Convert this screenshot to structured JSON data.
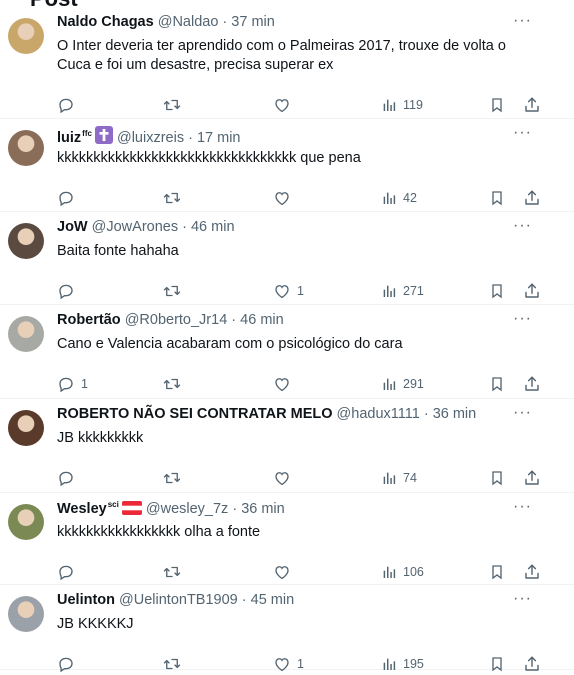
{
  "posts": [
    {
      "name": "Naldo Chagas",
      "handle": "@Naldao",
      "time": "37 min",
      "text": "O Inter deveria ter aprendido com o Palmeiras 2017, trouxe de volta o Cuca e foi um desastre, precisa superar ex",
      "replies": "",
      "likes": "",
      "views": "119",
      "avatar_color": "#c9a76a"
    },
    {
      "name": "luiz",
      "name_sup": "ffc",
      "handle": "@luixzreis",
      "time": "17 min",
      "text": "kkkkkkkkkkkkkkkkkkkkkkkkkkkkkkkkk que pena",
      "replies": "",
      "likes": "",
      "views": "42",
      "badge": "cross-badge",
      "avatar_color": "#8a6d58"
    },
    {
      "name": "JoW",
      "handle": "@JowArones",
      "time": "46 min",
      "text": "Baita fonte hahaha",
      "replies": "",
      "likes": "1",
      "views": "271",
      "avatar_color": "#5b4a3f"
    },
    {
      "name": "Robertão",
      "handle": "@R0berto_Jr14",
      "time": "46 min",
      "text": "Cano e Valencia acabaram com o psicológico do cara",
      "replies": "1",
      "likes": "",
      "views": "291",
      "avatar_color": "#a7a9a5"
    },
    {
      "name": "ROBERTO NÃO SEI CONTRATAR MELO",
      "handle": "@hadux1111",
      "time": "36 min",
      "text": "JB kkkkkkkkk",
      "replies": "",
      "likes": "",
      "views": "74",
      "avatar_color": "#5a3a2a"
    },
    {
      "name": "Wesley",
      "name_sup": "sci",
      "handle": "@wesley_7z",
      "time": "36 min",
      "text": "kkkkkkkkkkkkkkkkk olha a fonte",
      "replies": "",
      "likes": "",
      "views": "106",
      "badge": "austria-flag",
      "avatar_color": "#7b8a55"
    },
    {
      "name": "Uelinton",
      "handle": "@UelintonTB1909",
      "time": "45 min",
      "text": "JB KKKKKJ",
      "replies": "",
      "likes": "1",
      "views": "195",
      "avatar_color": "#9aa1a8"
    }
  ],
  "colors": {
    "text": "#0f1419",
    "secondary": "#536471",
    "divider": "#eff3f4"
  }
}
